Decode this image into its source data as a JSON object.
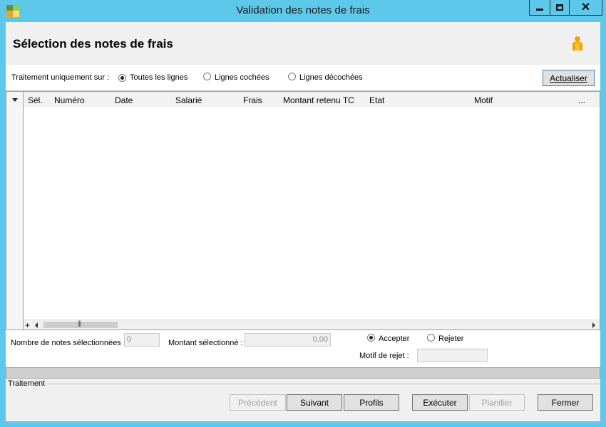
{
  "window": {
    "title": "Validation des notes de frais",
    "buttons": {
      "minimize": "minimize-icon",
      "maximize": "maximize-icon",
      "close": "close-icon"
    }
  },
  "header": {
    "title": "Sélection des notes de frais",
    "user_icon": "user-icon"
  },
  "filter": {
    "label": "Traitement uniquement sur :",
    "options": [
      {
        "label": "Toutes les lignes",
        "checked": true
      },
      {
        "label": "Lignes cochées",
        "checked": false
      },
      {
        "label": "Lignes décochées",
        "checked": false
      }
    ],
    "refresh_button": "Actualiser"
  },
  "grid": {
    "columns": [
      "Sél.",
      "Numéro",
      "Date",
      "Salarié",
      "Frais",
      "Montant retenu TC",
      "Etat",
      "Motif",
      "..."
    ],
    "rows": [],
    "scroll_plus": "+"
  },
  "summary": {
    "count_label": "Nombre de notes sélectionnées :",
    "count_value": "0",
    "amount_label": "Montant sélectionné :",
    "amount_value": "0,00",
    "accept_label": "Accepter",
    "reject_label": "Rejeter",
    "decision": "Accepter",
    "reject_reason_label": "Motif de rejet :",
    "reject_reason_value": ""
  },
  "footer": {
    "group_label": "Traitement",
    "buttons": {
      "previous": "Précédent",
      "next": "Suivant",
      "profiles": "Profils",
      "execute": "Exécuter",
      "schedule": "Planifier",
      "close": "Fermer"
    }
  },
  "colors": {
    "window_accent": "#5ec8ea",
    "background": "#f0f0f0"
  }
}
